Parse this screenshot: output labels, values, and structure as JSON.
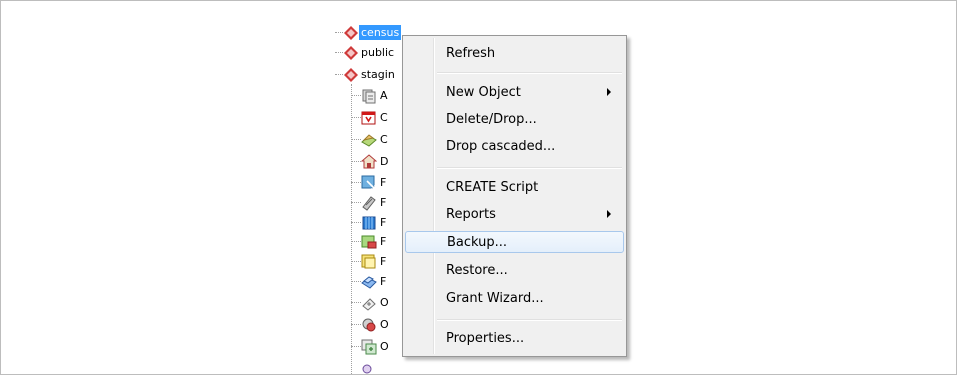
{
  "tree": {
    "schemas": [
      {
        "label": "census",
        "selected": true,
        "icon": "schema-icon"
      },
      {
        "label": "public",
        "selected": false,
        "icon": "schema-icon"
      },
      {
        "label": "stagin",
        "selected": false,
        "icon": "schema-icon"
      }
    ],
    "children": [
      {
        "label": "A",
        "icon": "aggregates-icon"
      },
      {
        "label": "C",
        "icon": "collations-icon"
      },
      {
        "label": "C",
        "icon": "conversions-icon"
      },
      {
        "label": "D",
        "icon": "domains-icon"
      },
      {
        "label": "F",
        "icon": "foreign-tables-icon"
      },
      {
        "label": "F",
        "icon": "fts-configurations-icon"
      },
      {
        "label": "F",
        "icon": "fts-dictionaries-icon"
      },
      {
        "label": "F",
        "icon": "fts-parsers-icon"
      },
      {
        "label": "F",
        "icon": "fts-templates-icon"
      },
      {
        "label": "F",
        "icon": "functions-icon"
      },
      {
        "label": "O",
        "icon": "operators-icon"
      },
      {
        "label": "O",
        "icon": "operator-classes-icon"
      },
      {
        "label": "O",
        "icon": "operator-families-icon"
      }
    ]
  },
  "context_menu": {
    "refresh": "Refresh",
    "new_object": "New Object",
    "delete_drop": "Delete/Drop...",
    "drop_cascaded": "Drop cascaded...",
    "create_script": "CREATE Script",
    "reports": "Reports",
    "backup": "Backup...",
    "restore": "Restore...",
    "grant_wizard": "Grant Wizard...",
    "properties": "Properties..."
  },
  "colors": {
    "selection": "#3399ff",
    "menu_background": "#f0f0f0",
    "menu_hover_border": "#a8c8ec",
    "schema_icon": "#cf3a3a"
  }
}
